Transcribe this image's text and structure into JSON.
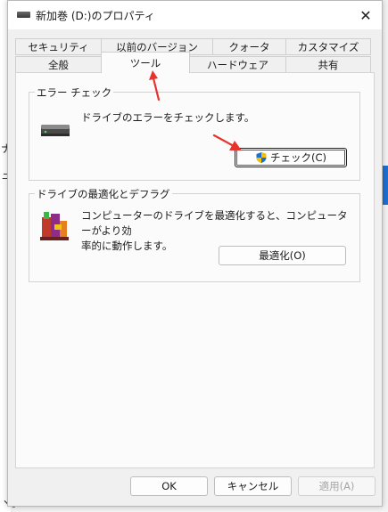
{
  "window": {
    "title": "新加巻 (D:)のプロパティ",
    "close_glyph": "✕"
  },
  "background": {
    "left_fragments": [
      "ナ",
      "ュ",
      "ヽ。"
    ]
  },
  "tabs": {
    "row_top": [
      {
        "label": "セキュリティ"
      },
      {
        "label": "以前のバージョン"
      },
      {
        "label": "クォータ"
      },
      {
        "label": "カスタマイズ"
      }
    ],
    "row_bottom": [
      {
        "label": "全般"
      },
      {
        "label": "ツール",
        "active": true
      },
      {
        "label": "ハードウェア"
      },
      {
        "label": "共有"
      }
    ]
  },
  "error_check": {
    "legend": "エラー チェック",
    "description": "ドライブのエラーをチェックします。",
    "button_label": "チェック(C)",
    "icon": "hard-drive-icon"
  },
  "optimize": {
    "legend": "ドライブの最適化とデフラグ",
    "description_line1": "コンピューターのドライブを最適化すると、コンピューターがより効",
    "description_line2": "率的に動作します。",
    "button_label": "最適化(O)",
    "icon": "defrag-icon"
  },
  "footer": {
    "ok_label": "OK",
    "cancel_label": "キャンセル",
    "apply_label": "適用(A)"
  },
  "colors": {
    "annotation_arrow": "#e8322c",
    "shield_blue": "#1e6fd0",
    "shield_yellow": "#f2c200"
  }
}
